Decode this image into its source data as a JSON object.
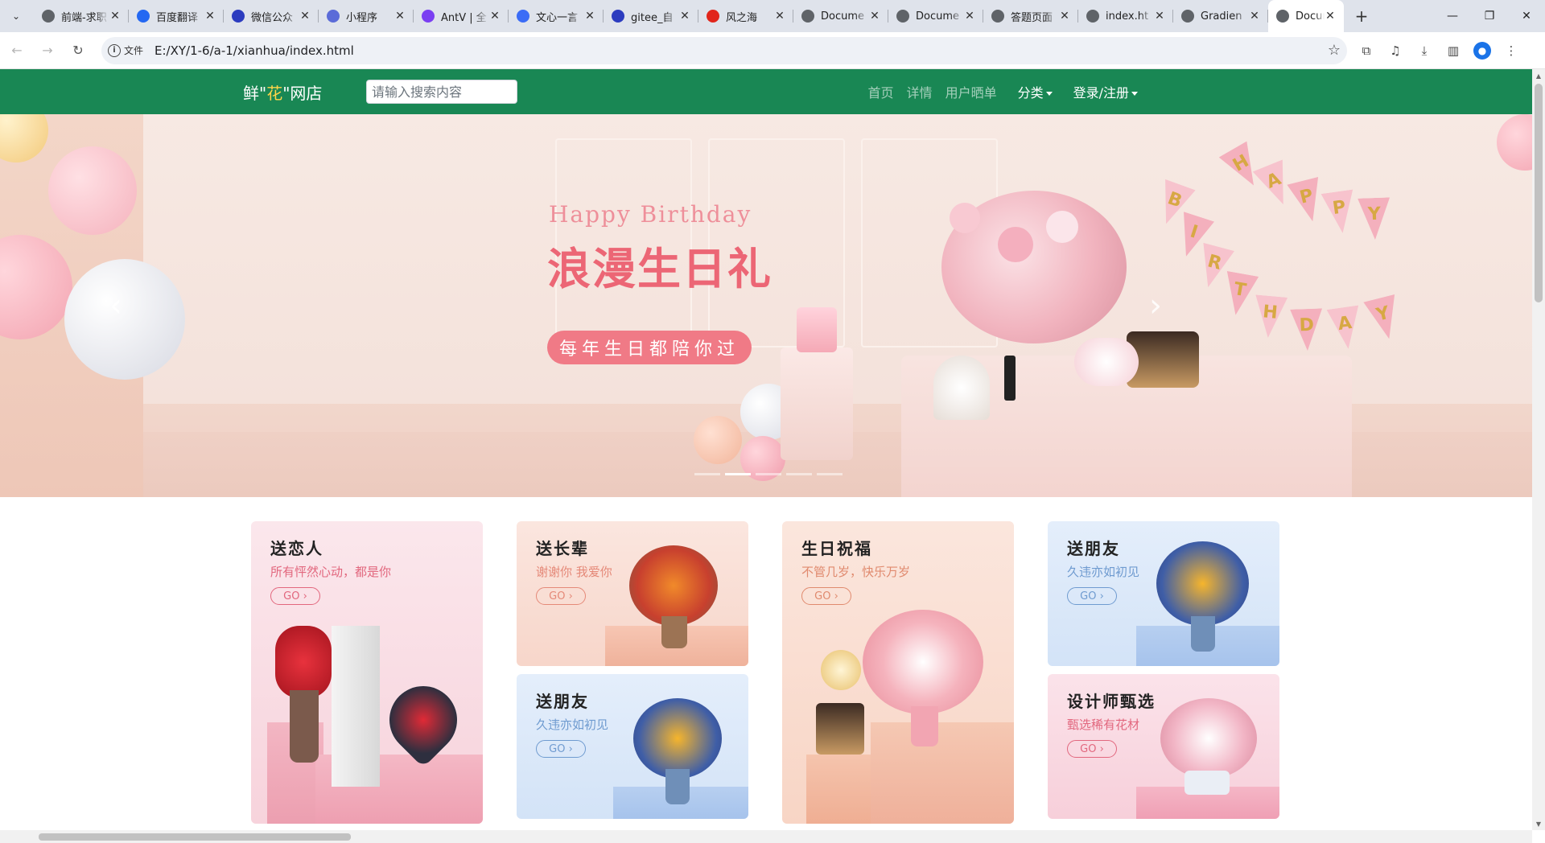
{
  "browser": {
    "tabs": [
      {
        "title": "前端-求职",
        "favicon_color": "#5f6368"
      },
      {
        "title": "百度翻译",
        "favicon_color": "#2468f2"
      },
      {
        "title": "微信公众",
        "favicon_color": "#2c3cbf"
      },
      {
        "title": "小程序",
        "favicon_color": "#5b6bd8"
      },
      {
        "title": "AntV | 全",
        "favicon_color": "#7b3ff2"
      },
      {
        "title": "文心一言",
        "favicon_color": "#3b6cf6"
      },
      {
        "title": "gitee_自",
        "favicon_color": "#2c3cbf"
      },
      {
        "title": "风之海",
        "favicon_color": "#e1251b"
      },
      {
        "title": "Docume",
        "favicon_color": "#5f6368"
      },
      {
        "title": "Docume",
        "favicon_color": "#5f6368"
      },
      {
        "title": "答题页面",
        "favicon_color": "#5f6368"
      },
      {
        "title": "index.ht",
        "favicon_color": "#5f6368"
      },
      {
        "title": "Gradien",
        "favicon_color": "#5f6368"
      },
      {
        "title": "Docume",
        "favicon_color": "#5f6368",
        "active": true
      }
    ],
    "address": {
      "scheme_label": "文件",
      "url": "E:/XY/1-6/a-1/xianhua/index.html"
    },
    "zoom": "125"
  },
  "site": {
    "brand": {
      "prefix": "鲜\"",
      "highlight": "花",
      "suffix": "\"网店"
    },
    "search_placeholder": "请输入搜索内容",
    "menu": {
      "home": "首页",
      "detail": "详情",
      "share": "用户晒单",
      "category": "分类",
      "login": "登录/注册"
    },
    "colors": {
      "nav_bg": "#198754",
      "brand_highlight": "#ffd54a"
    }
  },
  "hero": {
    "subtitle": "Happy Birthday",
    "title": "浪漫生日礼",
    "pill": "每年生日都陪你过",
    "banner_letters": [
      "H",
      "A",
      "P",
      "P",
      "Y",
      "B",
      "I",
      "R",
      "T",
      "H",
      "D",
      "A",
      "Y"
    ],
    "prev_icon": "‹",
    "next_icon": "›",
    "indicator_count": 5,
    "active_indicator": 1
  },
  "cards": [
    {
      "title": "送恋人",
      "subtitle": "所有怦然心动，都是你",
      "go": "GO ›",
      "accent": "#e2677e"
    },
    {
      "title": "送长辈",
      "subtitle": "谢谢你 我爱你",
      "go": "GO ›",
      "accent": "#e58978"
    },
    {
      "title": "生日祝福",
      "subtitle": "不管几岁，快乐万岁",
      "go": "GO ›",
      "accent": "#e08a6e"
    },
    {
      "title": "送朋友",
      "subtitle": "久违亦如初见",
      "go": "GO ›",
      "accent": "#6f9bd0"
    },
    {
      "title": "送朋友",
      "subtitle": "久违亦如初见",
      "go": "GO ›",
      "accent": "#6f9bd0"
    },
    {
      "title": "设计师甄选",
      "subtitle": "甄选稀有花材",
      "go": "GO ›",
      "accent": "#e2677e"
    }
  ]
}
